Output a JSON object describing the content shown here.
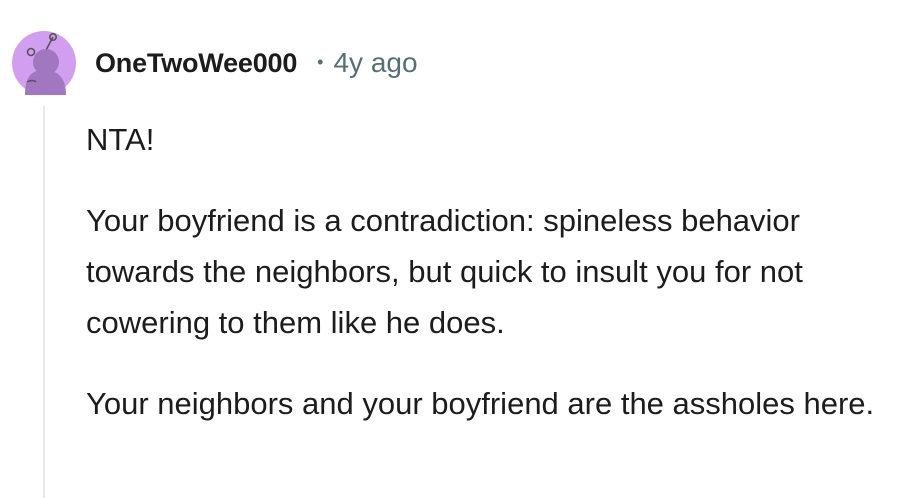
{
  "comment": {
    "author": "OneTwoWee000",
    "separator": "•",
    "timestamp": "4y ago",
    "avatar": {
      "icon": "snoo-avatar-icon",
      "background_color": "#d19ef0",
      "figure_color": "#a077c0"
    },
    "paragraphs": [
      "NTA!",
      "Your boyfriend is a contradiction: spineless behavior towards the neighbors, but quick to insult you for not cowering to them like he does.",
      "Your neighbors and your boyfriend are the assholes here."
    ]
  },
  "colors": {
    "text": "#1c1c1c",
    "meta": "#576f76",
    "thread_line": "#e5ebee"
  }
}
